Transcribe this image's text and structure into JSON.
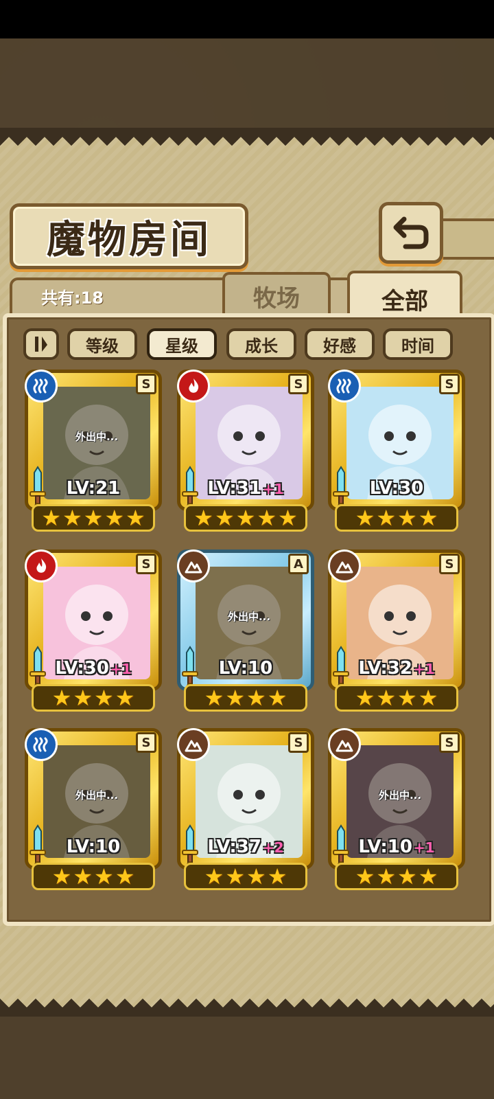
{
  "page": {
    "title": "魔物房间",
    "count_label": "共有:18",
    "tabs": [
      {
        "label": "牧场",
        "active": false
      },
      {
        "label": "全部",
        "active": true
      }
    ],
    "sort_buttons": [
      {
        "label": "等级",
        "active": false
      },
      {
        "label": "星级",
        "active": true
      },
      {
        "label": "成长",
        "active": false
      },
      {
        "label": "好感",
        "active": false
      },
      {
        "label": "时间",
        "active": false
      }
    ]
  },
  "cards": [
    {
      "element": "water",
      "rank": "S",
      "level": "LV:21",
      "plus": "",
      "stars": 5,
      "status": "外出中...",
      "frame": "gold",
      "bg": "#8e9a7a"
    },
    {
      "element": "fire",
      "rank": "S",
      "level": "LV:31",
      "plus": "+1",
      "stars": 5,
      "status": "",
      "frame": "gold",
      "bg": "#d9c9e6"
    },
    {
      "element": "water",
      "rank": "S",
      "level": "LV:30",
      "plus": "",
      "stars": 4,
      "status": "",
      "frame": "gold",
      "bg": "#bfe4f5"
    },
    {
      "element": "fire",
      "rank": "S",
      "level": "LV:30",
      "plus": "+1",
      "stars": 4,
      "status": "",
      "frame": "gold",
      "bg": "#f7c2dc"
    },
    {
      "element": "earth",
      "rank": "A",
      "level": "LV:10",
      "plus": "",
      "stars": 4,
      "status": "外出中...",
      "frame": "blue",
      "bg": "#b4a878"
    },
    {
      "element": "earth",
      "rank": "S",
      "level": "LV:32",
      "plus": "+1",
      "stars": 4,
      "status": "",
      "frame": "gold",
      "bg": "#e9b48a"
    },
    {
      "element": "water",
      "rank": "S",
      "level": "LV:10",
      "plus": "",
      "stars": 4,
      "status": "外出中...",
      "frame": "gold",
      "bg": "#8a8560"
    },
    {
      "element": "earth",
      "rank": "S",
      "level": "LV:37",
      "plus": "+2",
      "stars": 4,
      "status": "",
      "frame": "gold",
      "bg": "#d6e3dc"
    },
    {
      "element": "earth",
      "rank": "S",
      "level": "LV:10",
      "plus": "+1",
      "stars": 4,
      "status": "外出中...",
      "frame": "gold",
      "bg": "#6d5a72"
    }
  ]
}
